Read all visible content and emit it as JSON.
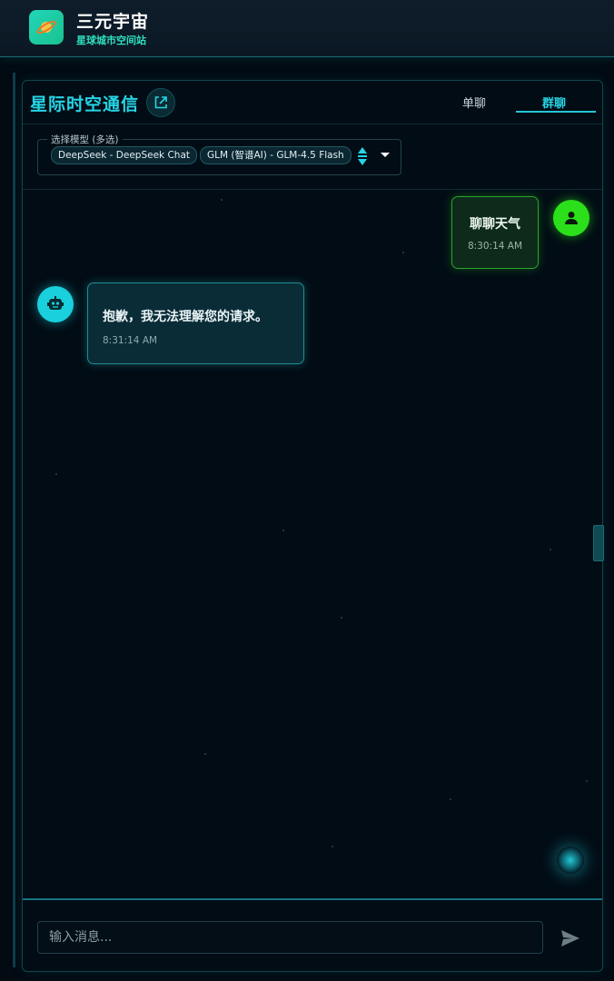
{
  "app": {
    "title": "三元宇宙",
    "subtitle": "星球城市空间站"
  },
  "panel": {
    "title": "星际时空通信",
    "tabs": [
      {
        "label": "单聊",
        "active": false
      },
      {
        "label": "群聊",
        "active": true
      }
    ]
  },
  "model_select": {
    "label": "选择模型 (多选)",
    "selected": [
      "DeepSeek - DeepSeek Chat",
      "GLM (智谱AI) - GLM-4.5 Flash"
    ]
  },
  "messages": [
    {
      "role": "user",
      "text": "聊聊天气",
      "time": "8:30:14 AM"
    },
    {
      "role": "assistant",
      "text": "抱歉，我无法理解您的请求。",
      "time": "8:31:14 AM"
    }
  ],
  "composer": {
    "placeholder": "输入消息..."
  },
  "colors": {
    "accent": "#25d5e5",
    "user": "#2be01a",
    "background": "#020a12"
  },
  "icons": {
    "logo": "planet-icon",
    "external": "external-link-icon",
    "user": "user-icon",
    "bot": "robot-icon",
    "send": "send-icon",
    "sort": "sort-icon",
    "dropdown": "caret-down-icon"
  }
}
